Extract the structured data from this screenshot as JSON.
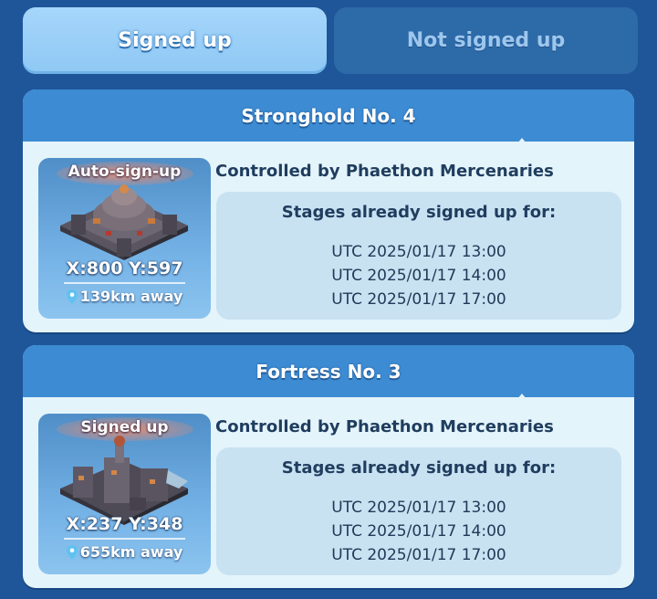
{
  "tabs": {
    "signed_up": "Signed up",
    "not_signed_up": "Not signed up"
  },
  "colors": {
    "background": "#1e5699",
    "tab_active": "#9acff8",
    "tab_inactive": "#2d6aa8",
    "card_header": "#3d8bd2",
    "card_body": "#e4f4fb",
    "stages_panel": "#c9e2f2"
  },
  "cards": [
    {
      "title": "Stronghold No. 4",
      "status": "Auto-sign-up",
      "coords": "X:800 Y:597",
      "distance": "139km away",
      "controlled_by": "Controlled by Phaethon Mercenaries",
      "stages_title": "Stages already signed up for:",
      "stages": [
        "UTC 2025/01/17 13:00",
        "UTC 2025/01/17 14:00",
        "UTC 2025/01/17 17:00"
      ]
    },
    {
      "title": "Fortress No. 3",
      "status": "Signed up",
      "coords": "X:237 Y:348",
      "distance": "655km away",
      "controlled_by": "Controlled by Phaethon Mercenaries",
      "stages_title": "Stages already signed up for:",
      "stages": [
        "UTC 2025/01/17 13:00",
        "UTC 2025/01/17 14:00",
        "UTC 2025/01/17 17:00"
      ]
    }
  ]
}
